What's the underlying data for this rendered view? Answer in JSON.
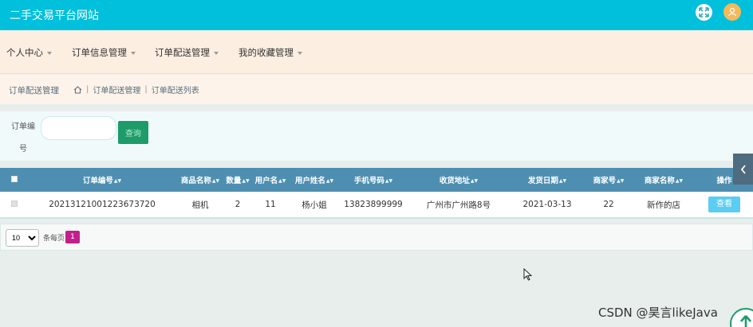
{
  "header": {
    "site_title": "二手交易平台网站"
  },
  "menu": [
    {
      "label": "个人中心"
    },
    {
      "label": "订单信息管理"
    },
    {
      "label": "订单配送管理"
    },
    {
      "label": "我的收藏管理"
    }
  ],
  "breadcrumb": {
    "title": "订单配送管理",
    "level1": "订单配送管理",
    "level2": "订单配送列表",
    "separator": "|"
  },
  "search": {
    "label_line1": "订单编",
    "label_line2": "号",
    "value": "",
    "placeholder": "",
    "button_label": "查询"
  },
  "table": {
    "columns": [
      "订单编号",
      "商品名称",
      "数量",
      "用户名",
      "用户姓名",
      "手机号码",
      "收货地址",
      "发货日期",
      "商家号",
      "商家名称",
      "操作"
    ],
    "rows": [
      {
        "order_no": "20213121001223673720",
        "product": "相机",
        "qty": "2",
        "username": "11",
        "realname": "杨小姐",
        "phone": "13823899999",
        "address": "广州市广州路8号",
        "ship_date": "2021-03-13",
        "merchant_no": "22",
        "merchant_name": "新作的店",
        "action": "查看"
      }
    ]
  },
  "pager": {
    "page_size": "10",
    "page_size_options": [
      "10"
    ],
    "per_page_text": "条每页",
    "current_page": "1"
  },
  "watermark": "CSDN @昊言likeJava",
  "colors": {
    "topbar": "#00c0dc",
    "table_header": "#4e8fb1",
    "search_button": "#1d9c6a",
    "view_button": "#5bcdf2",
    "active_page": "#c21f8b"
  }
}
